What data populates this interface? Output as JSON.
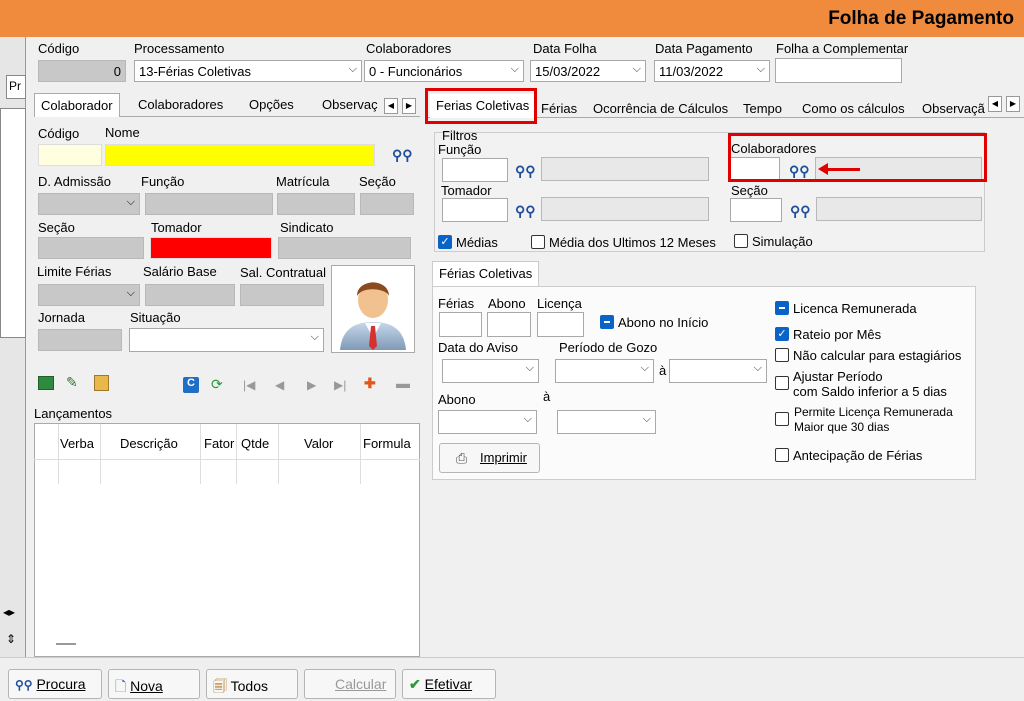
{
  "window": {
    "title": "Folha de Pagamento"
  },
  "top": {
    "codigo_label": "Código",
    "codigo_value": "0",
    "processamento_label": "Processamento",
    "processamento_value": "13-Férias Coletivas",
    "colaboradores_label": "Colaboradores",
    "colaboradores_value": "0 - Funcionários",
    "data_folha_label": "Data Folha",
    "data_folha_value": "15/03/2022",
    "data_pagamento_label": "Data Pagamento",
    "data_pagamento_value": "11/03/2022",
    "folha_complementar_label": "Folha a Complementar"
  },
  "left_tabs": [
    "Colaborador",
    "Colaboradores",
    "Opções",
    "Observaç"
  ],
  "right_tabs": [
    "Ferias Coletivas",
    "Férias",
    "Ocorrência de Cálculos",
    "Tempo",
    "Como os cálculos",
    "Observaçã"
  ],
  "left_panel": {
    "codigo": "Código",
    "nome": "Nome",
    "d_admissao": "D. Admissão",
    "funcao": "Função",
    "matricula": "Matrícula",
    "secao": "Seção",
    "secao2": "Seção",
    "tomador": "Tomador",
    "sindicato": "Sindicato",
    "limite_ferias": "Limite Férias",
    "salario_base": "Salário Base",
    "sal_contratual": "Sal. Contratual",
    "jornada": "Jornada",
    "situacao": "Situação",
    "lancamentos": "Lançamentos",
    "grid_headers": [
      "Verba",
      "Descrição",
      "Fator",
      "Qtde",
      "Valor",
      "Formula"
    ]
  },
  "filters": {
    "title": "Filtros",
    "funcao": "Função",
    "tomador": "Tomador",
    "colaboradores": "Colaboradores",
    "secao": "Seção"
  },
  "options": {
    "medias": "Médias",
    "media12": "Média dos Ultimos 12 Meses",
    "simulacao": "Simulação"
  },
  "ferias": {
    "tab": "Férias Coletivas",
    "ferias": "Férias",
    "abono": "Abono",
    "licenca": "Licença",
    "abono_inicio": "Abono no Início",
    "data_aviso": "Data do Aviso",
    "periodo_gozo": "Período de Gozo",
    "a1": "à",
    "a2": "à",
    "abono2": "Abono",
    "imprimir": "Imprimir",
    "licenca_remunerada": "Licenca Remunerada",
    "rateio": "Rateio por Mês",
    "nao_calcular": "Não calcular para estagiários",
    "ajustar1": "Ajustar Período",
    "ajustar2": "com Saldo inferior a 5 dias",
    "permite1": "Permite Licença Remunerada",
    "permite2": "Maior que 30 dias",
    "antecipacao": "Antecipação de Férias"
  },
  "bottom": {
    "procura": "Procura",
    "nova": "Nova",
    "todos": "Todos",
    "calcular": "Calcular",
    "efetivar": "Efetivar"
  },
  "left_strip": {
    "pr": "Pr"
  }
}
